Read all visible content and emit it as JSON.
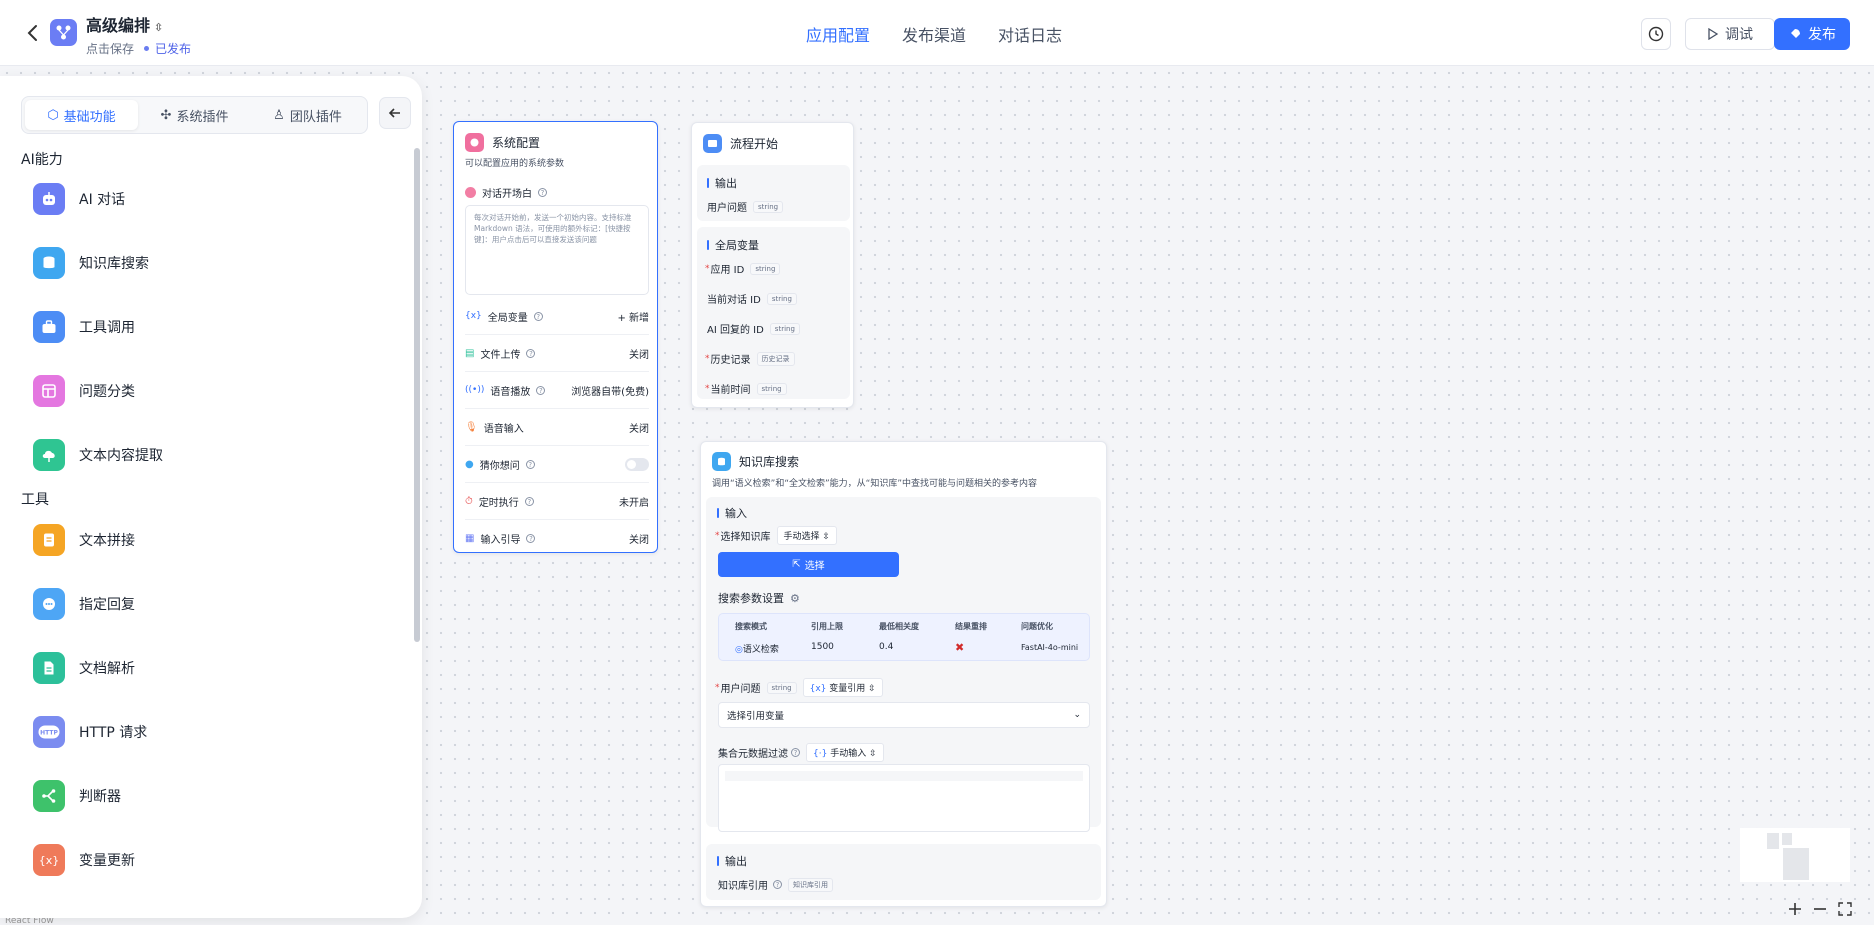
{
  "header": {
    "title": "高级编排",
    "save_hint": "点击保存",
    "status": "已发布",
    "tabs": [
      "应用配置",
      "发布渠道",
      "对话日志"
    ],
    "debug_label": "调试",
    "publish_label": "发布"
  },
  "sidebar": {
    "tabs": [
      "基础功能",
      "系统插件",
      "团队插件"
    ],
    "sections": [
      {
        "title": "AI能力",
        "items": [
          "AI 对话",
          "知识库搜索",
          "工具调用",
          "问题分类",
          "文本内容提取"
        ]
      },
      {
        "title": "工具",
        "items": [
          "文本拼接",
          "指定回复",
          "文档解析",
          "HTTP 请求",
          "判断器",
          "变量更新"
        ]
      }
    ]
  },
  "sysconfig": {
    "title": "系统配置",
    "desc": "可以配置应用的系统参数",
    "welcome_label": "对话开场白",
    "welcome_placeholder": "每次对话开始前，发送一个初始内容。支持标准 Markdown 语法，可使用的额外标记：[快捷按键]：用户点击后可以直接发送该问题",
    "rows": [
      {
        "label": "全局变量",
        "value": "+ 新增"
      },
      {
        "label": "文件上传",
        "value": "关闭"
      },
      {
        "label": "语音播放",
        "value": "浏览器自带(免费)"
      },
      {
        "label": "语音输入",
        "value": "关闭"
      },
      {
        "label": "猜你想问",
        "value": ""
      },
      {
        "label": "定时执行",
        "value": "未开启"
      },
      {
        "label": "输入引导",
        "value": "关闭"
      }
    ]
  },
  "flowstart": {
    "title": "流程开始",
    "output_title": "输出",
    "output_field": "用户问题",
    "output_type": "string",
    "globals_title": "全局变量",
    "globals": [
      {
        "label": "应用 ID",
        "type": "string",
        "required": true
      },
      {
        "label": "当前对话 ID",
        "type": "string",
        "required": false
      },
      {
        "label": "AI 回复的 ID",
        "type": "string",
        "required": false
      },
      {
        "label": "历史记录",
        "type": "历史记录",
        "required": true
      },
      {
        "label": "当前时间",
        "type": "string",
        "required": true
      }
    ]
  },
  "kbsearch": {
    "title": "知识库搜索",
    "desc": "调用“语义检索”和“全文检索”能力，从“知识库”中查找可能与问题相关的参考内容",
    "input_title": "输入",
    "select_kb_label": "选择知识库",
    "select_kb_mode": "手动选择",
    "select_button": "选择",
    "params_title": "搜索参数设置",
    "params_headers": [
      "搜索模式",
      "引用上限",
      "最低相关度",
      "结果重排",
      "问题优化"
    ],
    "params_values": [
      "语义检索",
      "1500",
      "0.4",
      "✖",
      "FastAI-4o-mini"
    ],
    "user_q_label": "用户问题",
    "user_q_type": "string",
    "user_q_mode": "变量引用",
    "user_q_placeholder": "选择引用变量",
    "filter_label": "集合元数据过滤",
    "filter_mode": "手动输入",
    "output_title": "输出",
    "output_field": "知识库引用",
    "output_type": "知识库引用"
  },
  "footer": {
    "reactflow": "React Flow"
  },
  "colors": {
    "accent": "#3370ff"
  }
}
